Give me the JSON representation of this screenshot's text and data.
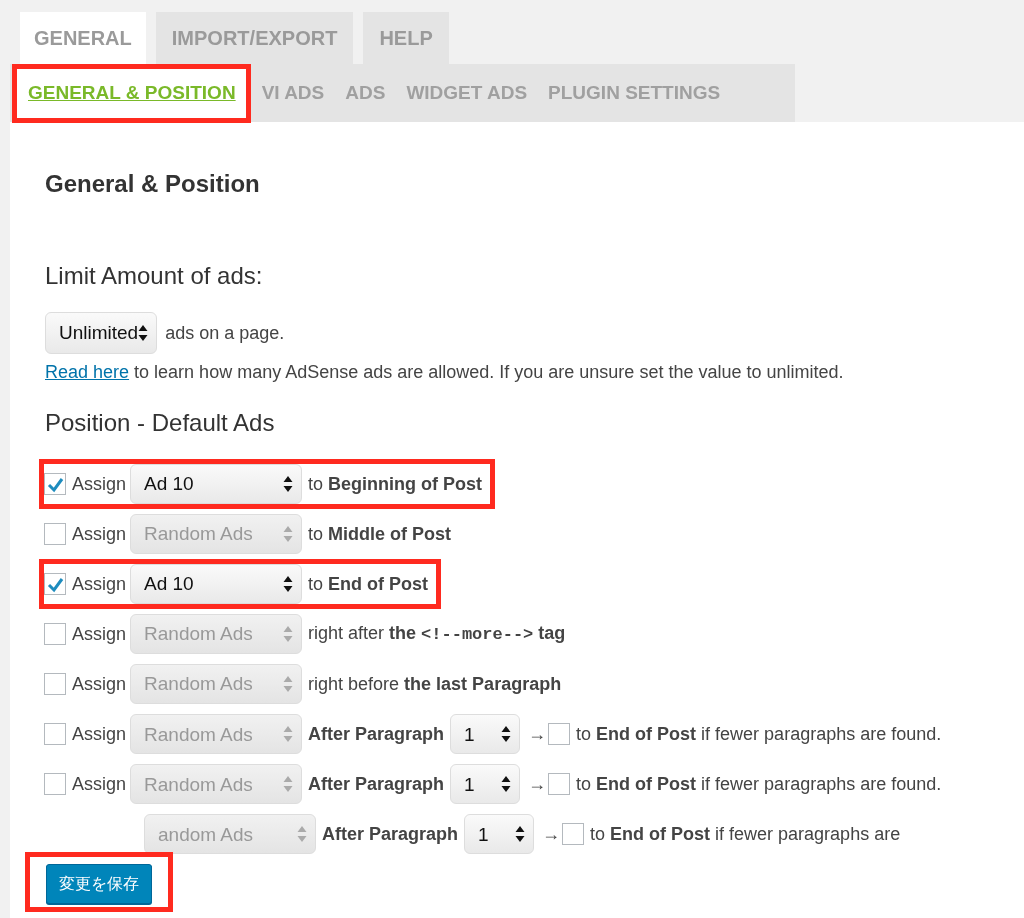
{
  "main_tabs": [
    {
      "label": "GENERAL",
      "selected": true
    },
    {
      "label": "IMPORT/EXPORT",
      "selected": false
    },
    {
      "label": "HELP",
      "selected": false
    }
  ],
  "sub_tabs": [
    {
      "label": "GENERAL & POSITION",
      "selected": true,
      "highlighted": true
    },
    {
      "label": "VI ADS",
      "selected": false,
      "highlighted": false
    },
    {
      "label": "ADS",
      "selected": false,
      "highlighted": false
    },
    {
      "label": "WIDGET ADS",
      "selected": false,
      "highlighted": false
    },
    {
      "label": "PLUGIN SETTINGS",
      "selected": false,
      "highlighted": false
    }
  ],
  "heading": "General & Position",
  "limit": {
    "heading": "Limit Amount of ads:",
    "select": "Unlimited",
    "suffix": "ads on a page.",
    "link": "Read here",
    "note": "to learn how many AdSense ads are allowed. If you are unsure set the value to unlimited."
  },
  "position": {
    "heading": "Position - Default Ads",
    "rows": [
      {
        "kind": "position",
        "checked": true,
        "label": "Assign",
        "select": {
          "value": "Ad 10",
          "disabled": false
        },
        "text": "to **Beginning of Post**",
        "highlighted": true
      },
      {
        "kind": "position",
        "checked": false,
        "label": "Assign",
        "select": {
          "value": "Random Ads",
          "disabled": true
        },
        "text": "to **Middle of Post**",
        "highlighted": false
      },
      {
        "kind": "position",
        "checked": true,
        "label": "Assign",
        "select": {
          "value": "Ad 10",
          "disabled": false
        },
        "text": "to **End of Post**",
        "highlighted": true
      },
      {
        "kind": "more_tag",
        "checked": false,
        "label": "Assign",
        "select": {
          "value": "Random Ads",
          "disabled": true
        },
        "text": "right after **the**",
        "code": "<!--more-->",
        "text_after": "**tag**",
        "highlighted": false
      },
      {
        "kind": "position",
        "checked": false,
        "label": "Assign",
        "select": {
          "value": "Random Ads",
          "disabled": true
        },
        "text": "right before **the last Paragraph**",
        "highlighted": false
      },
      {
        "kind": "paragraph",
        "checked": false,
        "label": "Assign",
        "select": {
          "value": "Random Ads",
          "disabled": true
        },
        "after": "After Paragraph",
        "paragraph": "1",
        "arrow": "→",
        "fallback_checked": false,
        "text": "to **End of Post** if fewer paragraphs are found.",
        "highlighted": false
      },
      {
        "kind": "paragraph",
        "checked": false,
        "label": "Assign",
        "select": {
          "value": "Random Ads",
          "disabled": true
        },
        "after": "After Paragraph",
        "paragraph": "1",
        "arrow": "→",
        "fallback_checked": false,
        "text": "to **End of Post** if fewer paragraphs are found.",
        "highlighted": false
      },
      {
        "kind": "paragraph",
        "select": {
          "value": "andom Ads",
          "disabled": true
        },
        "after": "After Paragraph",
        "paragraph": "1",
        "arrow": "→",
        "fallback_checked": false,
        "text": "to **End of Post** if fewer paragraphs are",
        "highlighted": false
      }
    ]
  },
  "save_button": {
    "label": "変更を保存",
    "highlighted": true
  }
}
